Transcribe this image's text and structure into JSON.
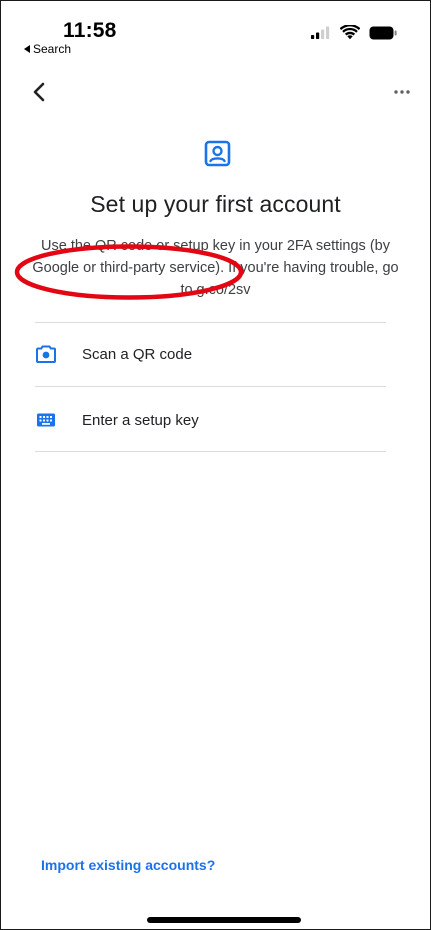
{
  "status_bar": {
    "time": "11:58",
    "back_label": "Search"
  },
  "header": {
    "back_icon": "chevron-left-icon",
    "menu_icon": "more-horizontal-icon"
  },
  "content": {
    "icon": "account-box-icon",
    "title": "Set up your first account",
    "description": "Use the QR code or setup key in your 2FA settings (by Google or third-party service). If you're having trouble, go to g.co/2sv"
  },
  "options": [
    {
      "label": "Scan a QR code",
      "icon": "camera-icon",
      "highlighted": true
    },
    {
      "label": "Enter a setup key",
      "icon": "keyboard-icon",
      "highlighted": false
    }
  ],
  "footer": {
    "import_link": "Import existing accounts?"
  },
  "colors": {
    "accent": "#1a73e8",
    "highlight": "#e30613",
    "divider": "#dadce0",
    "text": "#202124"
  }
}
